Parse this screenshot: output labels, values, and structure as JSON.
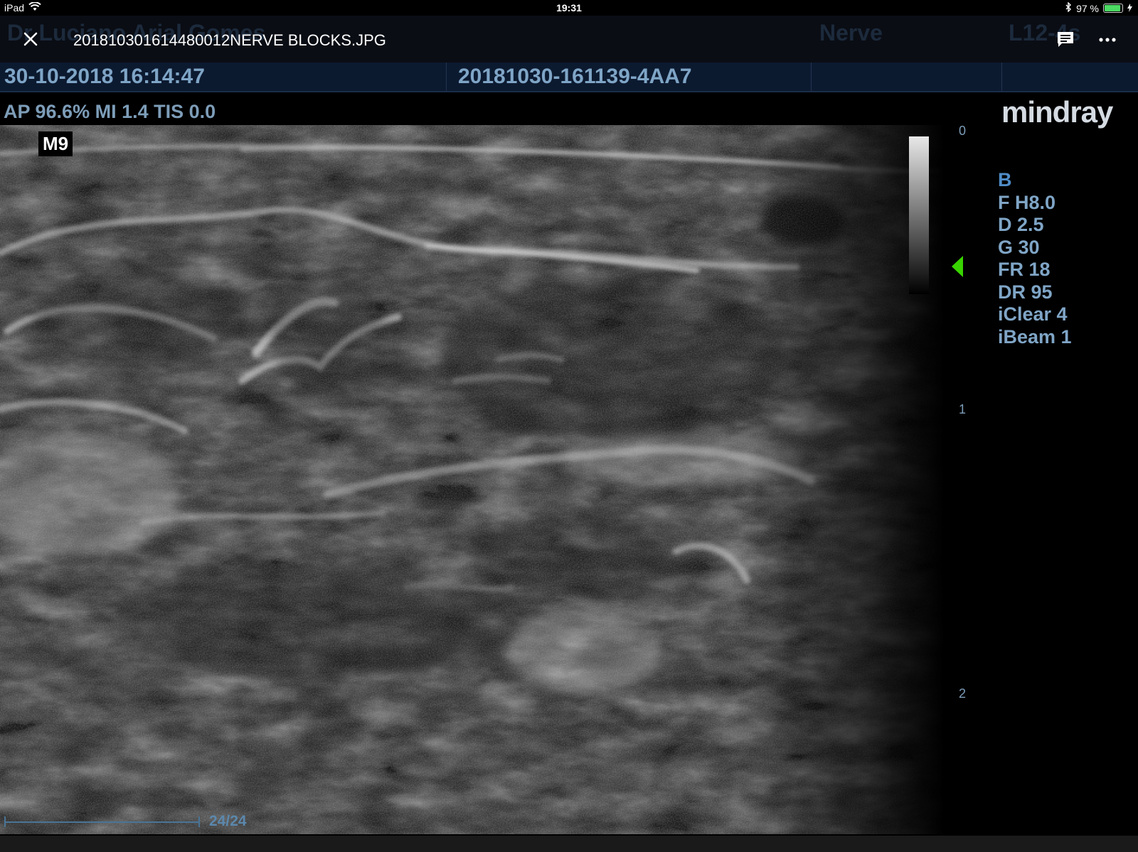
{
  "status_bar": {
    "device": "iPad",
    "time": "19:31",
    "battery": "97 %",
    "icons": {
      "wifi": "wifi-icon",
      "bluetooth": "bluetooth-icon",
      "battery": "battery-icon"
    }
  },
  "viewer": {
    "filename": "201810301614480012NERVE BLOCKS.JPG",
    "ghost_header": "Dr Luciano Arial Gomes",
    "ghost_nerve": "Nerve",
    "ghost_probe": "L12-4s",
    "icons": {
      "close": "close-icon",
      "comment": "comment-icon",
      "more": "more-icon"
    }
  },
  "info": {
    "datetime": "30-10-2018 16:14:47",
    "exam_id": "20181030-161139-4AA7"
  },
  "scan": {
    "power_line": "AP 96.6%  MI 1.4 TIS 0.0",
    "logo": "mindray",
    "preset": "M9",
    "depth_ticks": [
      "0",
      "1",
      "2"
    ],
    "params": [
      "B",
      "F H8.0",
      "D 2.5",
      "G 30",
      "FR 18",
      "DR 95",
      "iClear 4",
      "iBeam 1"
    ],
    "cine": {
      "frame_label": "24/24",
      "current": 24,
      "total": 24
    },
    "colors": {
      "focus": "#39d400",
      "text": "#7fa5c6"
    }
  }
}
